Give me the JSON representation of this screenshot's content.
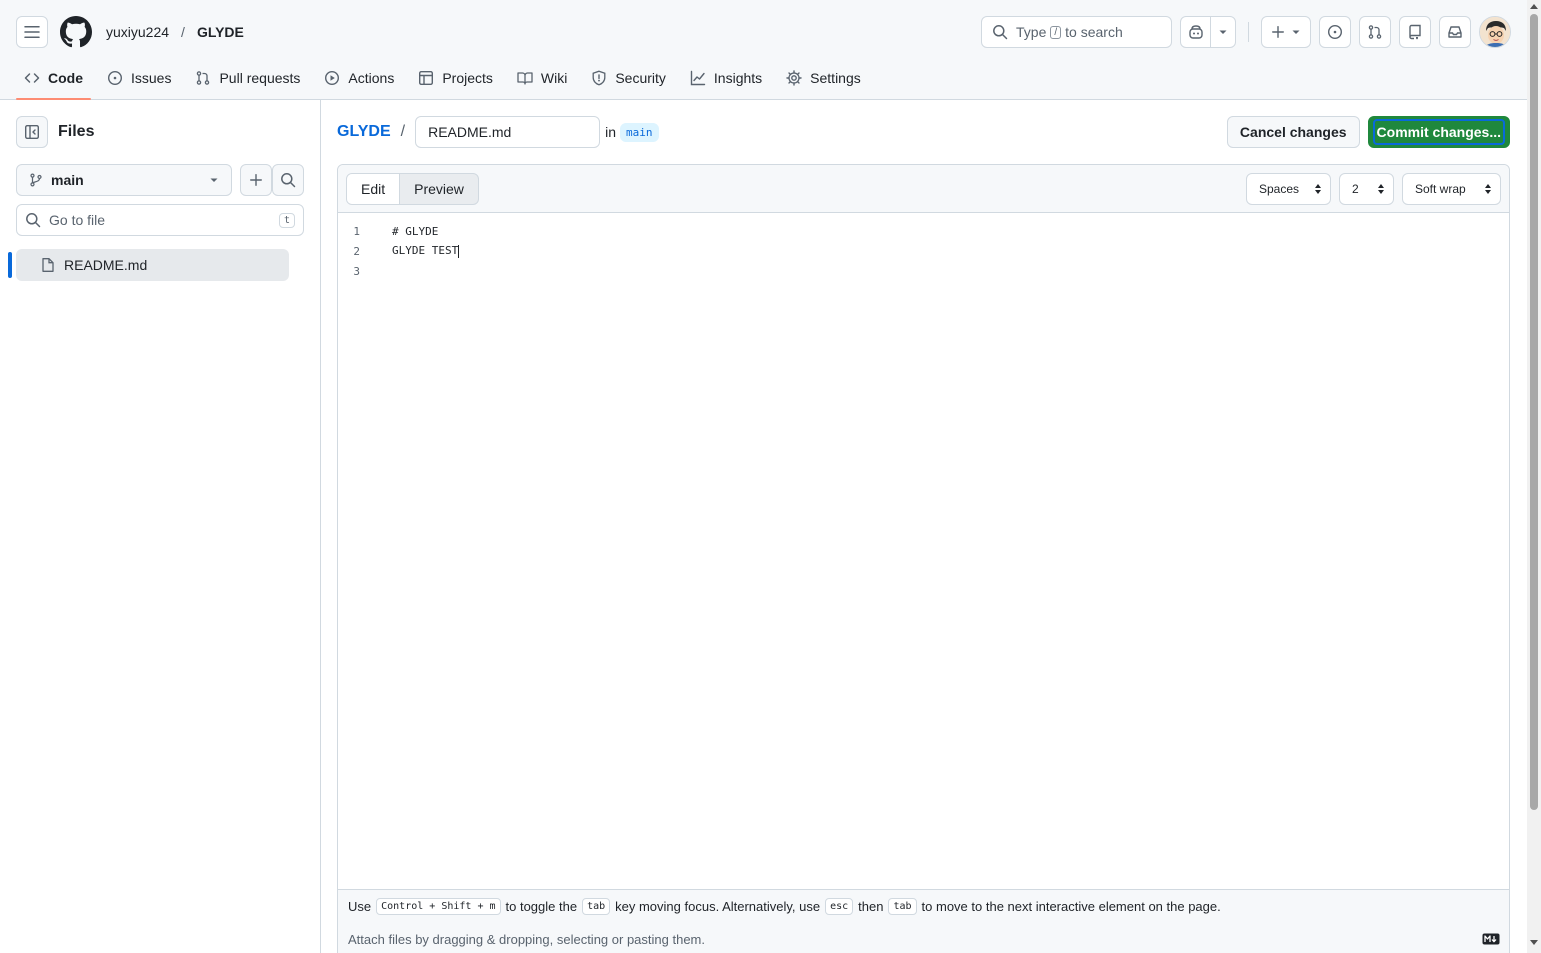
{
  "header": {
    "owner": "yuxiyu224",
    "separator": "/",
    "repo": "GLYDE",
    "search": {
      "prefix": "Type",
      "key": "/",
      "suffix": "to search"
    }
  },
  "tabs": [
    {
      "label": "Code",
      "icon": "code-icon",
      "active": true
    },
    {
      "label": "Issues",
      "icon": "issue-icon"
    },
    {
      "label": "Pull requests",
      "icon": "pull-request-icon"
    },
    {
      "label": "Actions",
      "icon": "play-icon"
    },
    {
      "label": "Projects",
      "icon": "table-icon"
    },
    {
      "label": "Wiki",
      "icon": "book-icon"
    },
    {
      "label": "Security",
      "icon": "shield-icon"
    },
    {
      "label": "Insights",
      "icon": "graph-icon"
    },
    {
      "label": "Settings",
      "icon": "gear-icon"
    }
  ],
  "sidebar": {
    "title": "Files",
    "branch": "main",
    "goto_placeholder": "Go to file",
    "goto_shortcut": "t",
    "files": [
      {
        "name": "README.md",
        "selected": true
      }
    ]
  },
  "editor_header": {
    "repo_link": "GLYDE",
    "separator": "/",
    "filename": "README.md",
    "in_label": "in",
    "branch": "main",
    "cancel_label": "Cancel changes",
    "commit_label": "Commit changes..."
  },
  "editor": {
    "tabs": [
      "Edit",
      "Preview"
    ],
    "active_tab": "Edit",
    "indent_mode": "Spaces",
    "indent_size": "2",
    "wrap_mode": "Soft wrap",
    "lines": [
      {
        "number": "1",
        "text": "# GLYDE"
      },
      {
        "number": "2",
        "text": "GLYDE TEST"
      },
      {
        "number": "3",
        "text": ""
      }
    ],
    "footer": {
      "hint_use": "Use",
      "hint_shortcut": "Control + Shift + m",
      "hint_toggle": "to toggle the",
      "hint_tab_key": "tab",
      "hint_key_moving": "key moving focus. Alternatively, use",
      "hint_esc": "esc",
      "hint_then": "then",
      "hint_tab_key2": "tab",
      "hint_end": "to move to the next interactive element on the page.",
      "attach": "Attach files by dragging & dropping, selecting or pasting them."
    }
  },
  "colors": {
    "accent": "#0969da",
    "commit_green": "#1f883d",
    "tab_underline": "#fd8c73"
  }
}
